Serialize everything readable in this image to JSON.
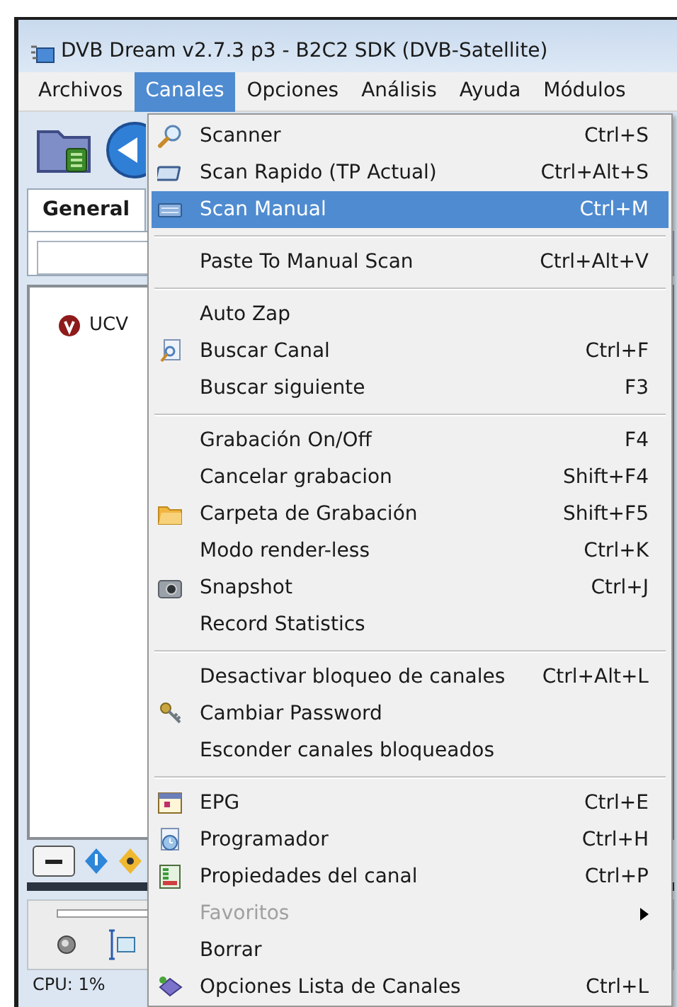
{
  "window": {
    "title": "DVB Dream v2.7.3 p3 - B2C2 SDK (DVB-Satellite)"
  },
  "menu_bar": [
    {
      "label": "Archivos",
      "selected": false
    },
    {
      "label": "Canales",
      "selected": true
    },
    {
      "label": "Opciones",
      "selected": false
    },
    {
      "label": "Análisis",
      "selected": false
    },
    {
      "label": "Ayuda",
      "selected": false
    },
    {
      "label": "Módulos",
      "selected": false
    }
  ],
  "tabs": [
    {
      "label": "General",
      "selected": true
    }
  ],
  "channel_list": [
    {
      "label": "UCV"
    }
  ],
  "status_bar": {
    "cpu": "CPU: 1%"
  },
  "dropdown_menu": {
    "groups": [
      [
        {
          "label": "Scanner",
          "shortcut": "Ctrl+S",
          "selected": false,
          "disabled": false,
          "submenu": false
        },
        {
          "label": "Scan Rapido (TP Actual)",
          "shortcut": "Ctrl+Alt+S",
          "selected": false,
          "disabled": false,
          "submenu": false
        },
        {
          "label": "Scan Manual",
          "shortcut": "Ctrl+M",
          "selected": true,
          "disabled": false,
          "submenu": false
        }
      ],
      [
        {
          "label": "Paste To Manual Scan",
          "shortcut": "Ctrl+Alt+V",
          "selected": false,
          "disabled": false,
          "submenu": false
        }
      ],
      [
        {
          "label": "Auto Zap",
          "selected": false,
          "disabled": false,
          "submenu": false
        },
        {
          "label": "Buscar Canal",
          "shortcut": "Ctrl+F",
          "selected": false,
          "disabled": false,
          "submenu": false
        },
        {
          "label": "Buscar siguiente",
          "shortcut": "F3",
          "selected": false,
          "disabled": false,
          "submenu": false
        }
      ],
      [
        {
          "label": "Grabación On/Off",
          "shortcut": "F4",
          "selected": false,
          "disabled": false,
          "submenu": false
        },
        {
          "label": "Cancelar grabacion",
          "shortcut": "Shift+F4",
          "selected": false,
          "disabled": false,
          "submenu": false
        },
        {
          "label": "Carpeta de Grabación",
          "shortcut": "Shift+F5",
          "selected": false,
          "disabled": false,
          "submenu": false
        },
        {
          "label": "Modo render-less",
          "shortcut": "Ctrl+K",
          "selected": false,
          "disabled": false,
          "submenu": false
        },
        {
          "label": "Snapshot",
          "shortcut": "Ctrl+J",
          "selected": false,
          "disabled": false,
          "submenu": false
        },
        {
          "label": "Record Statistics",
          "selected": false,
          "disabled": false,
          "submenu": false
        }
      ],
      [
        {
          "label": "Desactivar bloqueo de canales",
          "shortcut": "Ctrl+Alt+L",
          "selected": false,
          "disabled": false,
          "submenu": false
        },
        {
          "label": "Cambiar Password",
          "selected": false,
          "disabled": false,
          "submenu": false
        },
        {
          "label": "Esconder canales bloqueados",
          "selected": false,
          "disabled": false,
          "submenu": false
        }
      ],
      [
        {
          "label": "EPG",
          "shortcut": "Ctrl+E",
          "selected": false,
          "disabled": false,
          "submenu": false
        },
        {
          "label": "Programador",
          "shortcut": "Ctrl+H",
          "selected": false,
          "disabled": false,
          "submenu": false
        },
        {
          "label": "Propiedades del canal",
          "shortcut": "Ctrl+P",
          "selected": false,
          "disabled": false,
          "submenu": false
        },
        {
          "label": "Favoritos",
          "selected": false,
          "disabled": true,
          "submenu": true
        },
        {
          "label": "Borrar",
          "selected": false,
          "disabled": false,
          "submenu": false
        },
        {
          "label": "Opciones Lista de Canales",
          "shortcut": "Ctrl+L",
          "selected": false,
          "disabled": false,
          "submenu": false
        }
      ]
    ]
  }
}
